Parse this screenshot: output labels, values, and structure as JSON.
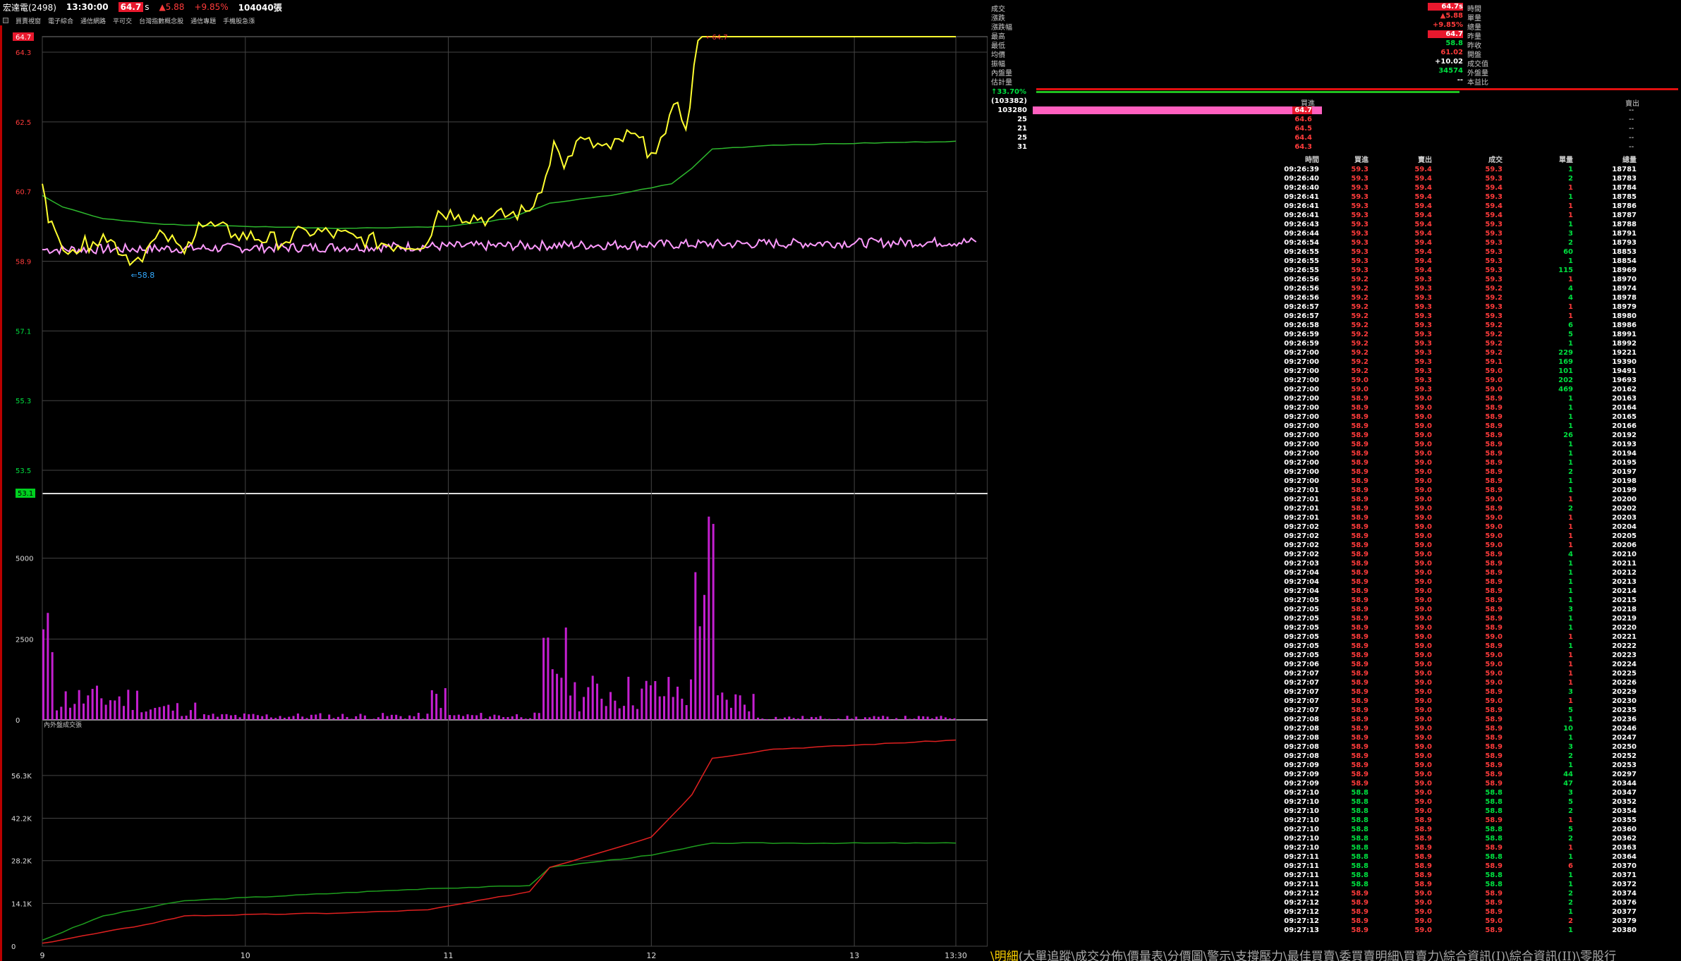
{
  "header": {
    "stock": "宏達電(2498)",
    "time": "13:30:00",
    "price": "64.7",
    "price_suffix": "s",
    "change": "▲5.88",
    "change_pct": "+9.85%",
    "volume": "104040張"
  },
  "toolbar": {
    "items": [
      "買賣視窗",
      "電子綜合",
      "通信網路",
      "平可交",
      "台灣指數概念股",
      "通信專題",
      "手機股急漲"
    ]
  },
  "colors": {
    "price_line": "#ffff30",
    "avg_line": "#2db82d",
    "index_line": "#ff9bff",
    "volume_bar": "#c41fd0",
    "cum_buy": "#e02020",
    "cum_sell": "#1e9e1e",
    "grid": "#444444",
    "up": "#ff3b3b",
    "down": "#00e040"
  },
  "chart_data": [
    {
      "type": "line",
      "name": "price",
      "ylim": [
        52.9,
        64.7
      ],
      "y_ticks": [
        "64.7",
        "64.3",
        "62.5",
        "60.7",
        "58.9",
        "57.1",
        "55.3",
        "53.5",
        "53.1"
      ],
      "x_ticks": [
        "9",
        "10",
        "11",
        "12",
        "13",
        "13:30"
      ],
      "high_label": "64.7",
      "low_label": "58.8",
      "series": [
        {
          "name": "price",
          "values": [
            [
              0,
              60.9
            ],
            [
              0.03,
              59.9
            ],
            [
              0.08,
              59.5
            ],
            [
              0.15,
              59.2
            ],
            [
              0.25,
              59.4
            ],
            [
              0.3,
              59.6
            ],
            [
              0.45,
              58.9
            ],
            [
              0.6,
              59.6
            ],
            [
              0.7,
              59.1
            ],
            [
              0.72,
              59.4
            ],
            [
              0.77,
              59.9
            ],
            [
              0.95,
              59.6
            ],
            [
              1.2,
              59.4
            ],
            [
              1.3,
              59.7
            ],
            [
              1.55,
              59.5
            ],
            [
              1.75,
              59.3
            ],
            [
              1.9,
              59.4
            ],
            [
              1.95,
              60.2
            ],
            [
              2.05,
              60.1
            ],
            [
              2.2,
              60.0
            ],
            [
              2.4,
              60.2
            ],
            [
              2.48,
              61.1
            ],
            [
              2.52,
              62.0
            ],
            [
              2.57,
              61.3
            ],
            [
              2.63,
              62.0
            ],
            [
              2.8,
              61.8
            ],
            [
              2.9,
              62.2
            ],
            [
              3.0,
              61.7
            ],
            [
              3.07,
              62.2
            ],
            [
              3.13,
              63.0
            ],
            [
              3.17,
              62.3
            ],
            [
              3.23,
              64.6
            ],
            [
              3.25,
              64.7
            ],
            [
              4.5,
              64.7
            ]
          ]
        },
        {
          "name": "average",
          "values": [
            [
              0,
              60.6
            ],
            [
              0.1,
              60.3
            ],
            [
              0.3,
              60.0
            ],
            [
              0.6,
              59.85
            ],
            [
              1.0,
              59.8
            ],
            [
              1.5,
              59.75
            ],
            [
              2.0,
              59.8
            ],
            [
              2.3,
              60.0
            ],
            [
              2.5,
              60.4
            ],
            [
              2.8,
              60.6
            ],
            [
              3.1,
              60.9
            ],
            [
              3.2,
              61.3
            ],
            [
              3.3,
              61.8
            ],
            [
              3.6,
              61.9
            ],
            [
              4.5,
              62.0
            ]
          ]
        },
        {
          "name": "index",
          "values": [
            [
              0,
              59.2
            ],
            [
              4.6,
              59.4
            ]
          ]
        }
      ]
    },
    {
      "type": "bar",
      "name": "volume",
      "ylim": [
        0,
        7000
      ],
      "y_ticks": [
        "5000",
        "2500",
        "0"
      ],
      "peak_values": [
        3500,
        6900,
        5800,
        3000,
        2800,
        1800,
        1700
      ]
    },
    {
      "type": "line",
      "name": "cumulative",
      "title": "內外盤成交張",
      "ylim": [
        0,
        70000
      ],
      "y_ticks": [
        "56.3K",
        "42.2K",
        "28.2K",
        "14.1K",
        "0"
      ],
      "series": [
        {
          "name": "outer",
          "values": [
            [
              0,
              1000
            ],
            [
              0.5,
              7000
            ],
            [
              0.7,
              10000
            ],
            [
              1.5,
              11000
            ],
            [
              1.9,
              12000
            ],
            [
              2.4,
              18000
            ],
            [
              2.5,
              26000
            ],
            [
              3.0,
              36000
            ],
            [
              3.2,
              50000
            ],
            [
              3.3,
              62000
            ],
            [
              3.6,
              65000
            ],
            [
              4.5,
              68000
            ]
          ]
        },
        {
          "name": "inner",
          "values": [
            [
              0,
              2000
            ],
            [
              0.3,
              10000
            ],
            [
              0.7,
              15000
            ],
            [
              1.9,
              19000
            ],
            [
              2.4,
              20000
            ],
            [
              2.5,
              26000
            ],
            [
              3.0,
              30000
            ],
            [
              3.3,
              34000
            ],
            [
              4.5,
              34000
            ]
          ]
        }
      ]
    }
  ],
  "quote": {
    "left_labels": [
      "成交",
      "漲跌",
      "漲跌幅",
      "最高",
      "最低",
      "均價",
      "振幅",
      "內盤量",
      "估計量"
    ],
    "right_labels": [
      "時間",
      "單量",
      "總量",
      "昨量",
      "昨收",
      "開盤",
      "成交值",
      "外盤量",
      "本益比"
    ],
    "left_values": [
      "64.7s",
      "▲5.88",
      "+9.85%",
      "64.7",
      "58.8",
      "61.02",
      "+10.02",
      "34574",
      "--"
    ],
    "right_values": [
      "",
      "",
      "",
      "",
      "",
      "",
      "",
      "",
      ""
    ],
    "ratio": "↑33.70%",
    "bid_label": "買進",
    "ask_label": "賣出",
    "total_bid": "(103382)",
    "book": [
      {
        "bid_qty": "103280",
        "bid": "64.7",
        "ask": "--"
      },
      {
        "bid_qty": "25",
        "bid": "64.6",
        "ask": "--"
      },
      {
        "bid_qty": "21",
        "bid": "64.5",
        "ask": "--"
      },
      {
        "bid_qty": "25",
        "bid": "64.4",
        "ask": "--"
      },
      {
        "bid_qty": "31",
        "bid": "64.3",
        "ask": "--"
      }
    ]
  },
  "ticks": {
    "headers": [
      "時間",
      "買進",
      "賣出",
      "成交",
      "單量",
      "總量"
    ],
    "rows": [
      [
        "09:26:39",
        "59.3",
        "59.4",
        "59.3",
        "1",
        "18781"
      ],
      [
        "09:26:40",
        "59.3",
        "59.4",
        "59.3",
        "2",
        "18783"
      ],
      [
        "09:26:40",
        "59.3",
        "59.4",
        "59.4",
        "1",
        "18784"
      ],
      [
        "09:26:41",
        "59.3",
        "59.4",
        "59.3",
        "1",
        "18785"
      ],
      [
        "09:26:41",
        "59.3",
        "59.4",
        "59.4",
        "1",
        "18786"
      ],
      [
        "09:26:41",
        "59.3",
        "59.4",
        "59.4",
        "1",
        "18787"
      ],
      [
        "09:26:43",
        "59.3",
        "59.4",
        "59.3",
        "1",
        "18788"
      ],
      [
        "09:26:44",
        "59.3",
        "59.4",
        "59.3",
        "3",
        "18791"
      ],
      [
        "09:26:54",
        "59.3",
        "59.4",
        "59.3",
        "2",
        "18793"
      ],
      [
        "09:26:55",
        "59.3",
        "59.4",
        "59.3",
        "60",
        "18853"
      ],
      [
        "09:26:55",
        "59.3",
        "59.4",
        "59.3",
        "1",
        "18854"
      ],
      [
        "09:26:55",
        "59.3",
        "59.4",
        "59.3",
        "115",
        "18969"
      ],
      [
        "09:26:56",
        "59.2",
        "59.3",
        "59.3",
        "1",
        "18970"
      ],
      [
        "09:26:56",
        "59.2",
        "59.3",
        "59.2",
        "4",
        "18974"
      ],
      [
        "09:26:56",
        "59.2",
        "59.3",
        "59.2",
        "4",
        "18978"
      ],
      [
        "09:26:57",
        "59.2",
        "59.3",
        "59.3",
        "1",
        "18979"
      ],
      [
        "09:26:57",
        "59.2",
        "59.3",
        "59.3",
        "1",
        "18980"
      ],
      [
        "09:26:58",
        "59.2",
        "59.3",
        "59.2",
        "6",
        "18986"
      ],
      [
        "09:26:59",
        "59.2",
        "59.3",
        "59.2",
        "5",
        "18991"
      ],
      [
        "09:26:59",
        "59.2",
        "59.3",
        "59.2",
        "1",
        "18992"
      ],
      [
        "09:27:00",
        "59.2",
        "59.3",
        "59.2",
        "229",
        "19221"
      ],
      [
        "09:27:00",
        "59.2",
        "59.3",
        "59.1",
        "169",
        "19390"
      ],
      [
        "09:27:00",
        "59.2",
        "59.3",
        "59.0",
        "101",
        "19491"
      ],
      [
        "09:27:00",
        "59.0",
        "59.3",
        "59.0",
        "202",
        "19693"
      ],
      [
        "09:27:00",
        "59.0",
        "59.3",
        "59.0",
        "469",
        "20162"
      ],
      [
        "09:27:00",
        "58.9",
        "59.0",
        "58.9",
        "1",
        "20163"
      ],
      [
        "09:27:00",
        "58.9",
        "59.0",
        "58.9",
        "1",
        "20164"
      ],
      [
        "09:27:00",
        "58.9",
        "59.0",
        "58.9",
        "1",
        "20165"
      ],
      [
        "09:27:00",
        "58.9",
        "59.0",
        "58.9",
        "1",
        "20166"
      ],
      [
        "09:27:00",
        "58.9",
        "59.0",
        "58.9",
        "26",
        "20192"
      ],
      [
        "09:27:00",
        "58.9",
        "59.0",
        "58.9",
        "1",
        "20193"
      ],
      [
        "09:27:00",
        "58.9",
        "59.0",
        "58.9",
        "1",
        "20194"
      ],
      [
        "09:27:00",
        "58.9",
        "59.0",
        "58.9",
        "1",
        "20195"
      ],
      [
        "09:27:00",
        "58.9",
        "59.0",
        "58.9",
        "2",
        "20197"
      ],
      [
        "09:27:00",
        "58.9",
        "59.0",
        "58.9",
        "1",
        "20198"
      ],
      [
        "09:27:01",
        "58.9",
        "59.0",
        "58.9",
        "1",
        "20199"
      ],
      [
        "09:27:01",
        "58.9",
        "59.0",
        "59.0",
        "1",
        "20200"
      ],
      [
        "09:27:01",
        "58.9",
        "59.0",
        "58.9",
        "2",
        "20202"
      ],
      [
        "09:27:01",
        "58.9",
        "59.0",
        "59.0",
        "1",
        "20203"
      ],
      [
        "09:27:02",
        "58.9",
        "59.0",
        "59.0",
        "1",
        "20204"
      ],
      [
        "09:27:02",
        "58.9",
        "59.0",
        "59.0",
        "1",
        "20205"
      ],
      [
        "09:27:02",
        "58.9",
        "59.0",
        "59.0",
        "1",
        "20206"
      ],
      [
        "09:27:02",
        "58.9",
        "59.0",
        "58.9",
        "4",
        "20210"
      ],
      [
        "09:27:03",
        "58.9",
        "59.0",
        "58.9",
        "1",
        "20211"
      ],
      [
        "09:27:04",
        "58.9",
        "59.0",
        "58.9",
        "1",
        "20212"
      ],
      [
        "09:27:04",
        "58.9",
        "59.0",
        "58.9",
        "1",
        "20213"
      ],
      [
        "09:27:04",
        "58.9",
        "59.0",
        "58.9",
        "1",
        "20214"
      ],
      [
        "09:27:05",
        "58.9",
        "59.0",
        "58.9",
        "1",
        "20215"
      ],
      [
        "09:27:05",
        "58.9",
        "59.0",
        "58.9",
        "3",
        "20218"
      ],
      [
        "09:27:05",
        "58.9",
        "59.0",
        "58.9",
        "1",
        "20219"
      ],
      [
        "09:27:05",
        "58.9",
        "59.0",
        "58.9",
        "1",
        "20220"
      ],
      [
        "09:27:05",
        "58.9",
        "59.0",
        "59.0",
        "1",
        "20221"
      ],
      [
        "09:27:05",
        "58.9",
        "59.0",
        "58.9",
        "1",
        "20222"
      ],
      [
        "09:27:05",
        "58.9",
        "59.0",
        "59.0",
        "1",
        "20223"
      ],
      [
        "09:27:06",
        "58.9",
        "59.0",
        "59.0",
        "1",
        "20224"
      ],
      [
        "09:27:07",
        "58.9",
        "59.0",
        "59.0",
        "1",
        "20225"
      ],
      [
        "09:27:07",
        "58.9",
        "59.0",
        "59.0",
        "1",
        "20226"
      ],
      [
        "09:27:07",
        "58.9",
        "59.0",
        "58.9",
        "3",
        "20229"
      ],
      [
        "09:27:07",
        "58.9",
        "59.0",
        "59.0",
        "1",
        "20230"
      ],
      [
        "09:27:07",
        "58.9",
        "59.0",
        "58.9",
        "5",
        "20235"
      ],
      [
        "09:27:08",
        "58.9",
        "59.0",
        "58.9",
        "1",
        "20236"
      ],
      [
        "09:27:08",
        "58.9",
        "59.0",
        "58.9",
        "10",
        "20246"
      ],
      [
        "09:27:08",
        "58.9",
        "59.0",
        "58.9",
        "1",
        "20247"
      ],
      [
        "09:27:08",
        "58.9",
        "59.0",
        "58.9",
        "3",
        "20250"
      ],
      [
        "09:27:08",
        "58.9",
        "59.0",
        "58.9",
        "2",
        "20252"
      ],
      [
        "09:27:09",
        "58.9",
        "59.0",
        "58.9",
        "1",
        "20253"
      ],
      [
        "09:27:09",
        "58.9",
        "59.0",
        "58.9",
        "44",
        "20297"
      ],
      [
        "09:27:09",
        "58.9",
        "59.0",
        "58.9",
        "47",
        "20344"
      ],
      [
        "09:27:10",
        "58.8",
        "59.0",
        "58.8",
        "3",
        "20347"
      ],
      [
        "09:27:10",
        "58.8",
        "59.0",
        "58.8",
        "5",
        "20352"
      ],
      [
        "09:27:10",
        "58.8",
        "59.0",
        "58.8",
        "2",
        "20354"
      ],
      [
        "09:27:10",
        "58.8",
        "58.9",
        "58.9",
        "1",
        "20355"
      ],
      [
        "09:27:10",
        "58.8",
        "58.9",
        "58.8",
        "5",
        "20360"
      ],
      [
        "09:27:10",
        "58.8",
        "58.9",
        "58.8",
        "2",
        "20362"
      ],
      [
        "09:27:10",
        "58.8",
        "58.9",
        "58.9",
        "1",
        "20363"
      ],
      [
        "09:27:11",
        "58.8",
        "58.9",
        "58.8",
        "1",
        "20364"
      ],
      [
        "09:27:11",
        "58.8",
        "58.9",
        "58.9",
        "6",
        "20370"
      ],
      [
        "09:27:11",
        "58.8",
        "58.9",
        "58.8",
        "1",
        "20371"
      ],
      [
        "09:27:11",
        "58.8",
        "58.9",
        "58.8",
        "1",
        "20372"
      ],
      [
        "09:27:12",
        "58.9",
        "59.0",
        "58.9",
        "2",
        "20374"
      ],
      [
        "09:27:12",
        "58.9",
        "59.0",
        "58.9",
        "2",
        "20376"
      ],
      [
        "09:27:12",
        "58.9",
        "59.0",
        "58.9",
        "1",
        "20377"
      ],
      [
        "09:27:12",
        "58.9",
        "59.0",
        "59.0",
        "2",
        "20379"
      ],
      [
        "09:27:13",
        "58.9",
        "59.0",
        "58.9",
        "1",
        "20380"
      ]
    ]
  },
  "tabs": {
    "active": "\\明細",
    "items": [
      "(大單追蹤",
      "\\成交分佈",
      "\\價量表",
      "\\分價圖",
      "\\警示",
      "\\支撐壓力",
      "\\最佳買賣",
      "\\委買賣明細",
      "\\買賣力",
      "\\綜合資訊(I)",
      "\\綜合資訊(II)",
      "\\零股行"
    ]
  }
}
